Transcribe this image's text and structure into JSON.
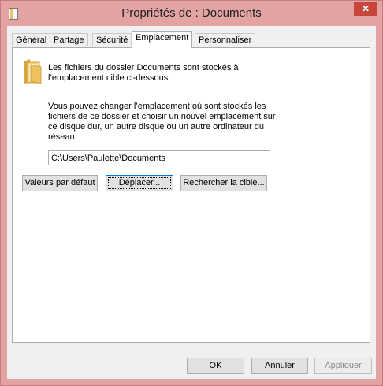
{
  "window": {
    "title": "Propriétés de : Documents",
    "close_glyph": "✕"
  },
  "tabs": [
    {
      "label": "Général"
    },
    {
      "label": "Partage"
    },
    {
      "label": "Sécurité"
    },
    {
      "label": "Emplacement"
    },
    {
      "label": "Personnaliser"
    }
  ],
  "active_tab": "Emplacement",
  "location": {
    "description1": "Les fichiers du dossier Documents sont stockés à l’emplacement cible ci-dessous.",
    "description2": "Vous pouvez changer l’emplacement où sont stockés les fichiers de ce dossier et choisir un nouvel emplacement sur ce disque dur, un autre disque ou un autre ordinateur du réseau.",
    "path_value": "C:\\Users\\Paulette\\Documents",
    "buttons": {
      "restore_default": "Valeurs par défaut",
      "move": "Déplacer...",
      "find_target": "Rechercher la cible..."
    }
  },
  "footer": {
    "ok": "OK",
    "cancel": "Annuler",
    "apply": "Appliquer"
  },
  "colors": {
    "frame": "#e3a3a3",
    "close": "#c7463c",
    "panel": "#ffffff"
  },
  "icons": {
    "app": "folder-properties-icon",
    "folder": "folder-icon",
    "close": "close-icon"
  }
}
